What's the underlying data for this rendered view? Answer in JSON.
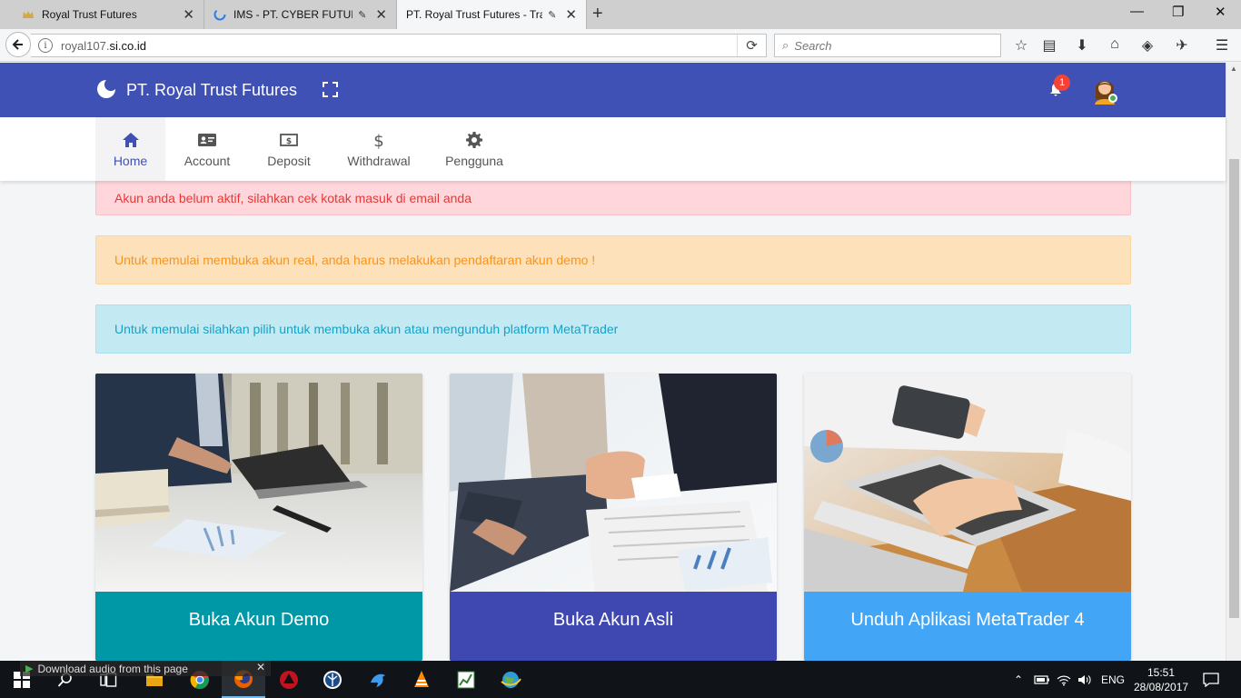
{
  "browser": {
    "tabs": [
      {
        "title": "Royal Trust Futures",
        "active": false
      },
      {
        "title": "IMS - PT. CYBER FUTURE",
        "active": false
      },
      {
        "title": "PT. Royal Trust Futures - Trad",
        "active": true
      }
    ],
    "url_prefix": "royal107.",
    "url_domain": "si.co.id",
    "search_placeholder": "Search"
  },
  "app": {
    "brand": "PT. Royal Trust Futures",
    "notification_count": "1",
    "colors": {
      "primary": "#3f51b5",
      "teal": "#0097a7",
      "indigo": "#3f48b0",
      "blue": "#42a5f5"
    }
  },
  "menu": {
    "items": [
      {
        "label": "Home",
        "icon": "home-icon",
        "active": true
      },
      {
        "label": "Account",
        "icon": "id-card-icon"
      },
      {
        "label": "Deposit",
        "icon": "money-icon"
      },
      {
        "label": "Withdrawal",
        "icon": "dollar-icon"
      },
      {
        "label": "Pengguna",
        "icon": "gear-icon"
      }
    ]
  },
  "alerts": {
    "danger": "Akun anda belum aktif, silahkan cek kotak masuk di email anda",
    "warning": "Untuk memulai membuka akun real, anda harus melakukan pendaftaran akun demo !",
    "info": "Untuk memulai silahkan pilih untuk membuka akun atau mengunduh platform MetaTrader"
  },
  "cards": [
    {
      "title": "Buka Akun Demo"
    },
    {
      "title": "Buka Akun Asli"
    },
    {
      "title": "Unduh Aplikasi MetaTrader 4"
    }
  ],
  "download_overlay": "Download audio from this page",
  "taskbar": {
    "language": "ENG",
    "time": "15:51",
    "date": "28/08/2017"
  }
}
